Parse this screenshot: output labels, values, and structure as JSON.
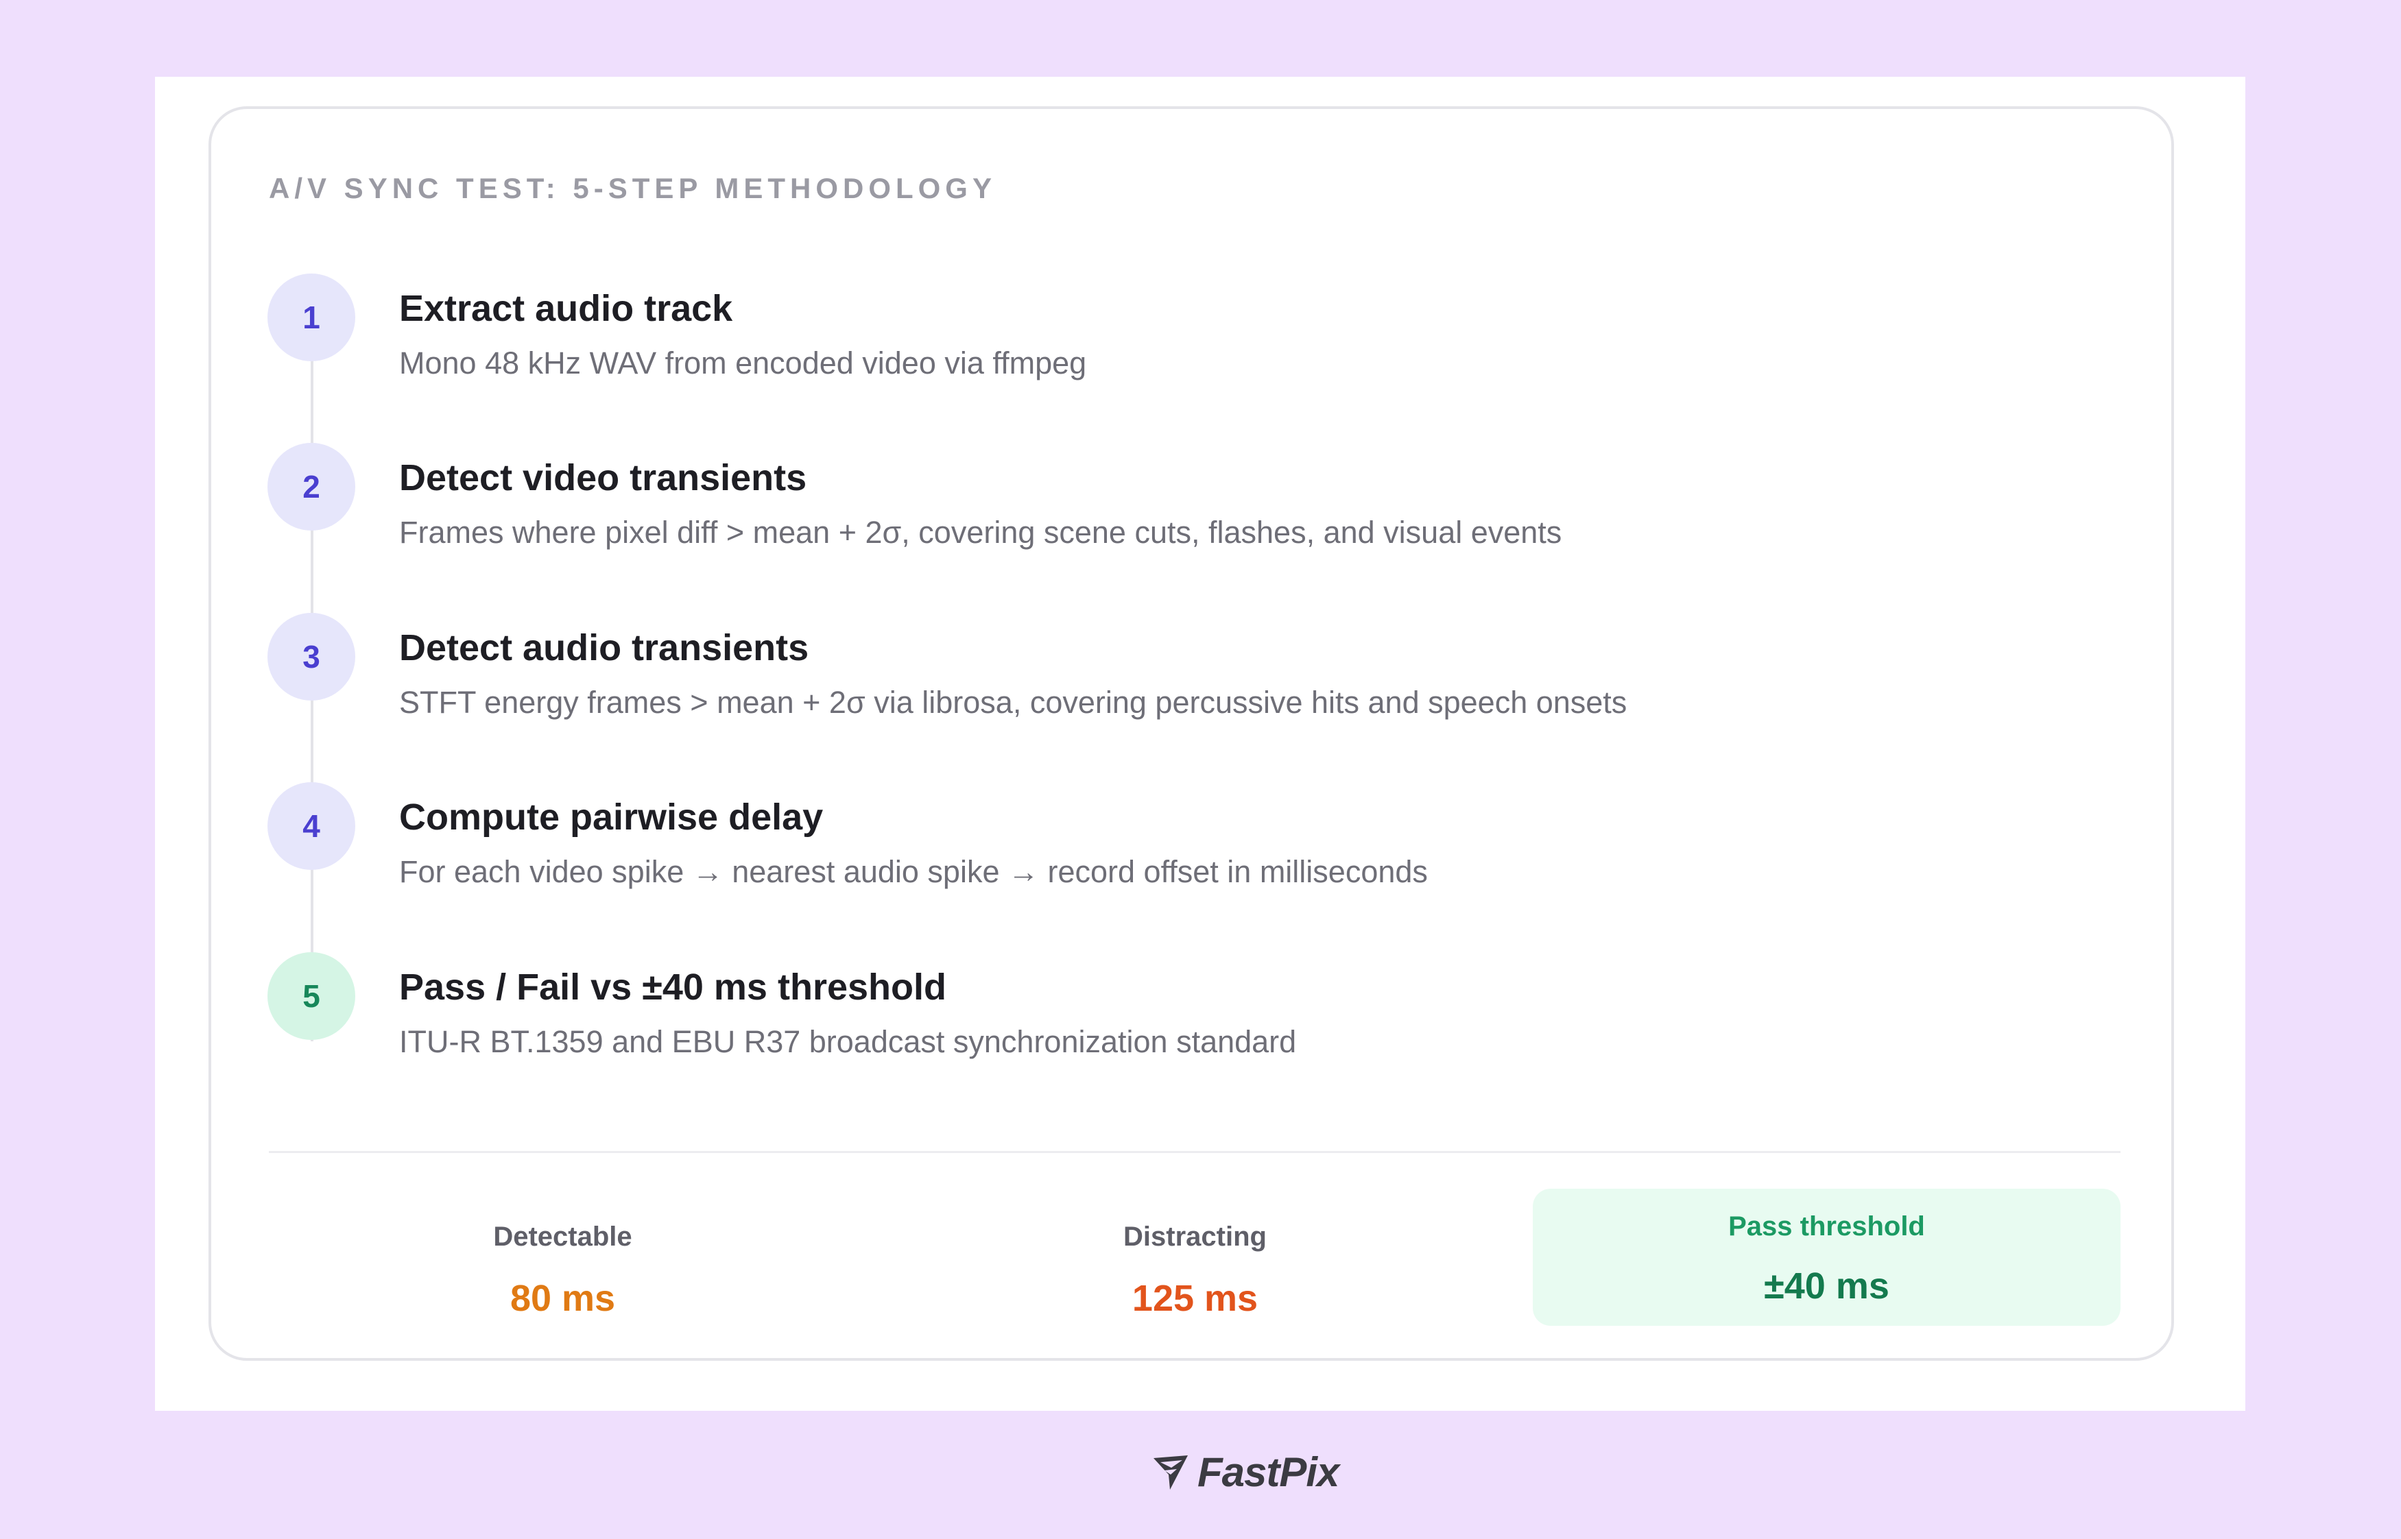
{
  "card": {
    "title": "A/V SYNC TEST: 5-STEP METHODOLOGY"
  },
  "steps": [
    {
      "number": "1",
      "title": "Extract audio track",
      "description": "Mono 48 kHz WAV from encoded video via ffmpeg"
    },
    {
      "number": "2",
      "title": "Detect video transients",
      "description": "Frames where pixel diff > mean + 2σ, covering scene cuts, flashes, and visual events"
    },
    {
      "number": "3",
      "title": "Detect audio transients",
      "description": "STFT energy frames > mean + 2σ via librosa, covering percussive hits and speech onsets"
    },
    {
      "number": "4",
      "title": "Compute pairwise delay",
      "description": "For each video spike → nearest audio spike → record offset in milliseconds"
    },
    {
      "number": "5",
      "title": "Pass / Fail vs ±40 ms threshold",
      "description": "ITU-R BT.1359 and EBU R37 broadcast synchronization standard"
    }
  ],
  "stats": [
    {
      "label": "Detectable",
      "value": "80 ms",
      "color": "#e07a14"
    },
    {
      "label": "Distracting",
      "value": "125 ms",
      "color": "#e2541c"
    },
    {
      "label": "Pass threshold",
      "value": "±40 ms",
      "color": "#147a4e"
    }
  ],
  "colors": {
    "background": "#efdffd",
    "step_circle": "#e6e6fb",
    "step_number": "#4a3fd0",
    "final_circle": "#d5f5e5",
    "final_number": "#17875a",
    "pass_box": "#e8fbf1"
  },
  "footer": {
    "brand": "FastPix",
    "icon": "fastpix-logo-icon"
  }
}
